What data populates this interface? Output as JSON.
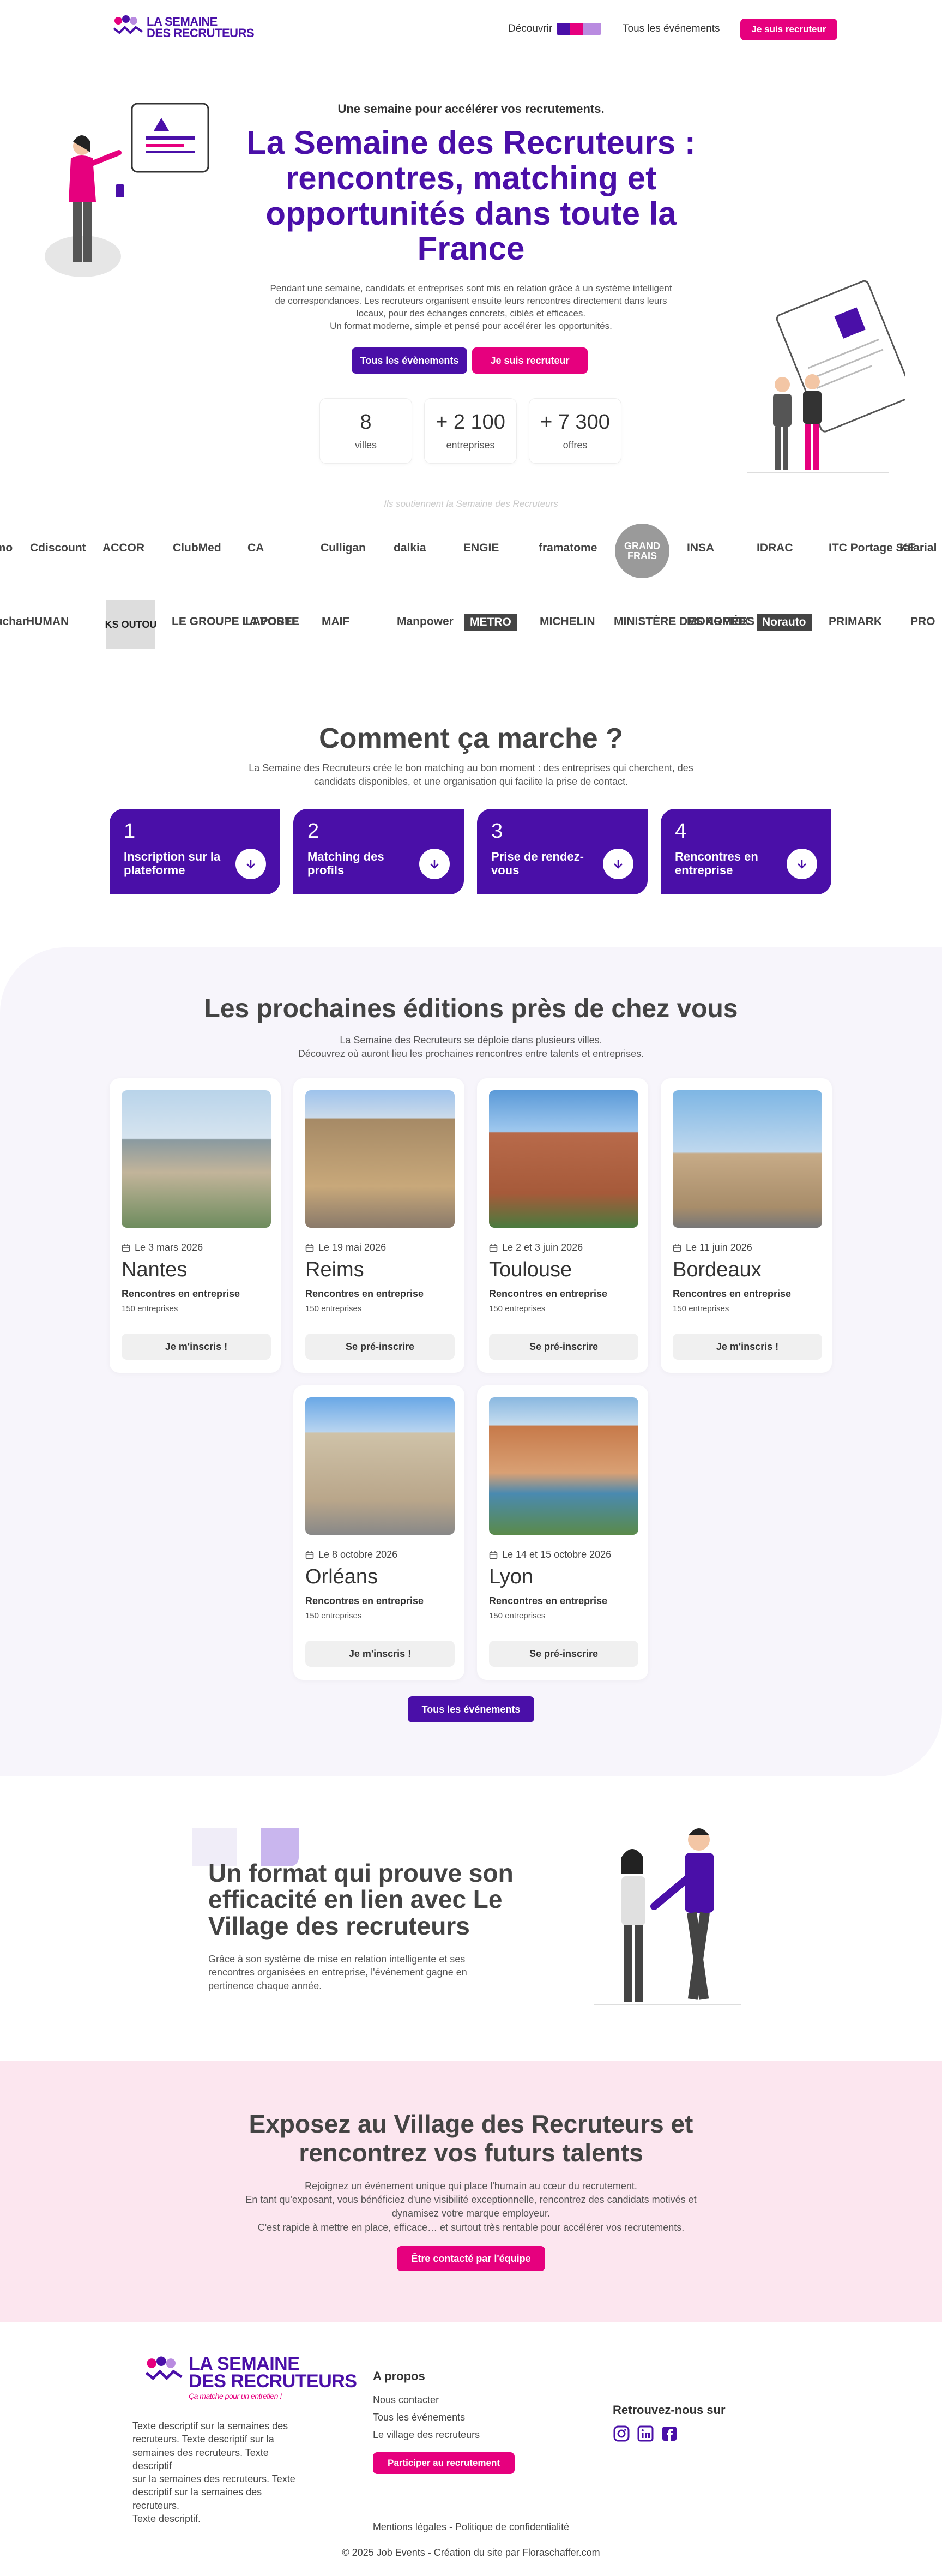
{
  "header": {
    "logo_line1": "LA SEMAINE",
    "logo_line2": "DES RECRUTEURS",
    "nav": {
      "discover": "Découvrir",
      "events": "Tous les événements",
      "recruiter": "Je suis recruteur"
    }
  },
  "hero": {
    "kicker": "Une semaine pour accélérer vos recrutements.",
    "title": "La Semaine des Recruteurs : rencontres, matching et opportunités dans toute la France",
    "desc_1": "Pendant une semaine, candidats et entreprises sont mis en relation grâce à un système intelligent",
    "desc_2": "de correspondances. Les recruteurs organisent ensuite leurs rencontres directement dans leurs",
    "desc_3": "locaux, pour des échanges concrets, ciblés et efficaces.",
    "desc_4": "Un format moderne, simple et pensé pour accélérer les opportunités.",
    "btn_events": "Tous les évènements",
    "btn_recruiter": "Je suis recruteur",
    "stats": [
      {
        "value": "8",
        "label": "villes"
      },
      {
        "value": "+ 2 100",
        "label": "entreprises"
      },
      {
        "value": "+ 7 300",
        "label": "offres"
      }
    ]
  },
  "partners": {
    "caption": "Ils soutiennent la Semaine des Recruteurs",
    "row1": [
      "emo",
      "Cdiscount",
      "ACCOR",
      "ClubMed",
      "CA",
      "Culligan",
      "dalkia",
      "ENGIE",
      "framatome",
      "GRAND FRAIS",
      "INSA",
      "IDRAC",
      "ITC Portage Salarial",
      "KE"
    ],
    "row2": [
      "auchan",
      "HUMAN",
      "KS OUTOU",
      "LE GROUPE LA POSTE",
      "LAVOREL",
      "MAIF",
      "Manpower",
      "METRO",
      "MICHELIN",
      "MINISTÈRE DES ARMÉES",
      "MONOPRIX",
      "Norauto",
      "PRIMARK",
      "PRO"
    ]
  },
  "how": {
    "title": "Comment ça marche ?",
    "desc_1": "La Semaine des Recruteurs crée le bon matching au bon moment : des entreprises qui cherchent, des",
    "desc_2": "candidats disponibles, et une organisation qui facilite la prise de contact.",
    "steps": [
      {
        "n": "1",
        "label": "Inscription sur la plateforme"
      },
      {
        "n": "2",
        "label": "Matching des profils"
      },
      {
        "n": "3",
        "label": "Prise de rendez-vous"
      },
      {
        "n": "4",
        "label": "Rencontres en entreprise"
      }
    ]
  },
  "editions": {
    "title": "Les prochaines éditions près de chez vous",
    "desc_1": "La Semaine des Recruteurs se déploie dans plusieurs villes.",
    "desc_2": "Découvrez où auront lieu les prochaines rencontres entre talents et entreprises.",
    "cards": [
      {
        "date": "Le 3 mars 2026",
        "city": "Nantes",
        "sub": "Rencontres en entreprise",
        "count": "150 entreprises",
        "btn": "Je m'inscris !"
      },
      {
        "date": "Le 19 mai 2026",
        "city": "Reims",
        "sub": "Rencontres en entreprise",
        "count": "150 entreprises",
        "btn": "Se pré-inscrire"
      },
      {
        "date": "Le 2 et 3 juin 2026",
        "city": "Toulouse",
        "sub": "Rencontres en entreprise",
        "count": "150 entreprises",
        "btn": "Se pré-inscrire"
      },
      {
        "date": "Le 11 juin 2026",
        "city": "Bordeaux",
        "sub": "Rencontres en entreprise",
        "count": "150 entreprises",
        "btn": "Je m'inscris !"
      },
      {
        "date": "Le 8 octobre 2026",
        "city": "Orléans",
        "sub": "Rencontres en entreprise",
        "count": "150 entreprises",
        "btn": "Je m'inscris !"
      },
      {
        "date": "Le 14 et 15 octobre 2026",
        "city": "Lyon",
        "sub": "Rencontres en entreprise",
        "count": "150 entreprises",
        "btn": "Se pré-inscrire"
      }
    ],
    "btn_all": "Tous les événements"
  },
  "format": {
    "title_1": "Un format qui prouve son",
    "title_2": "efficacité en lien avec Le",
    "title_3": "Village des recruteurs",
    "desc_1": "Grâce à son système de mise en relation intelligente et ses",
    "desc_2": "rencontres organisées en entreprise, l'événement gagne en",
    "desc_3": "pertinence chaque année."
  },
  "village": {
    "title_1": "Exposez au Village des Recruteurs et",
    "title_2": "rencontrez vos futurs talents",
    "desc_1": "Rejoignez un événement unique qui place l'humain au cœur du recrutement.",
    "desc_2": "En tant qu'exposant, vous bénéficiez d'une visibilité exceptionnelle, rencontrez des candidats motivés et",
    "desc_3": "dynamisez votre marque employeur.",
    "desc_4": "C'est rapide à mettre en place, efficace… et surtout très rentable pour accélérer vos recrutements.",
    "btn": "Être contacté par l'équipe"
  },
  "footer": {
    "tagline": "Ça matche pour un entretien !",
    "desc_1": "Texte descriptif sur la semaines des",
    "desc_2": "recruteurs. Texte descriptif sur la",
    "desc_3": "semaines des recruteurs. Texte descriptif",
    "desc_4": "sur la semaines des recruteurs. Texte",
    "desc_5": "descriptif sur la semaines des recruteurs.",
    "desc_6": "Texte descriptif.",
    "about_title": "A propos",
    "links": [
      "Nous contacter",
      "Tous les événements",
      "Le village des recruteurs"
    ],
    "btn": "Participer au recrutement",
    "social_title": "Retrouvez-nous sur",
    "legal": "Mentions légales - Politique de confidentialité",
    "copyright": "© 2025 Job Events - Création du site par Floraschaffer.com"
  },
  "colors": {
    "purple": "#4a0fa8",
    "pink": "#e6007e",
    "soft_bg": "#f7f5fb",
    "pink_bg": "#fce6ef"
  }
}
